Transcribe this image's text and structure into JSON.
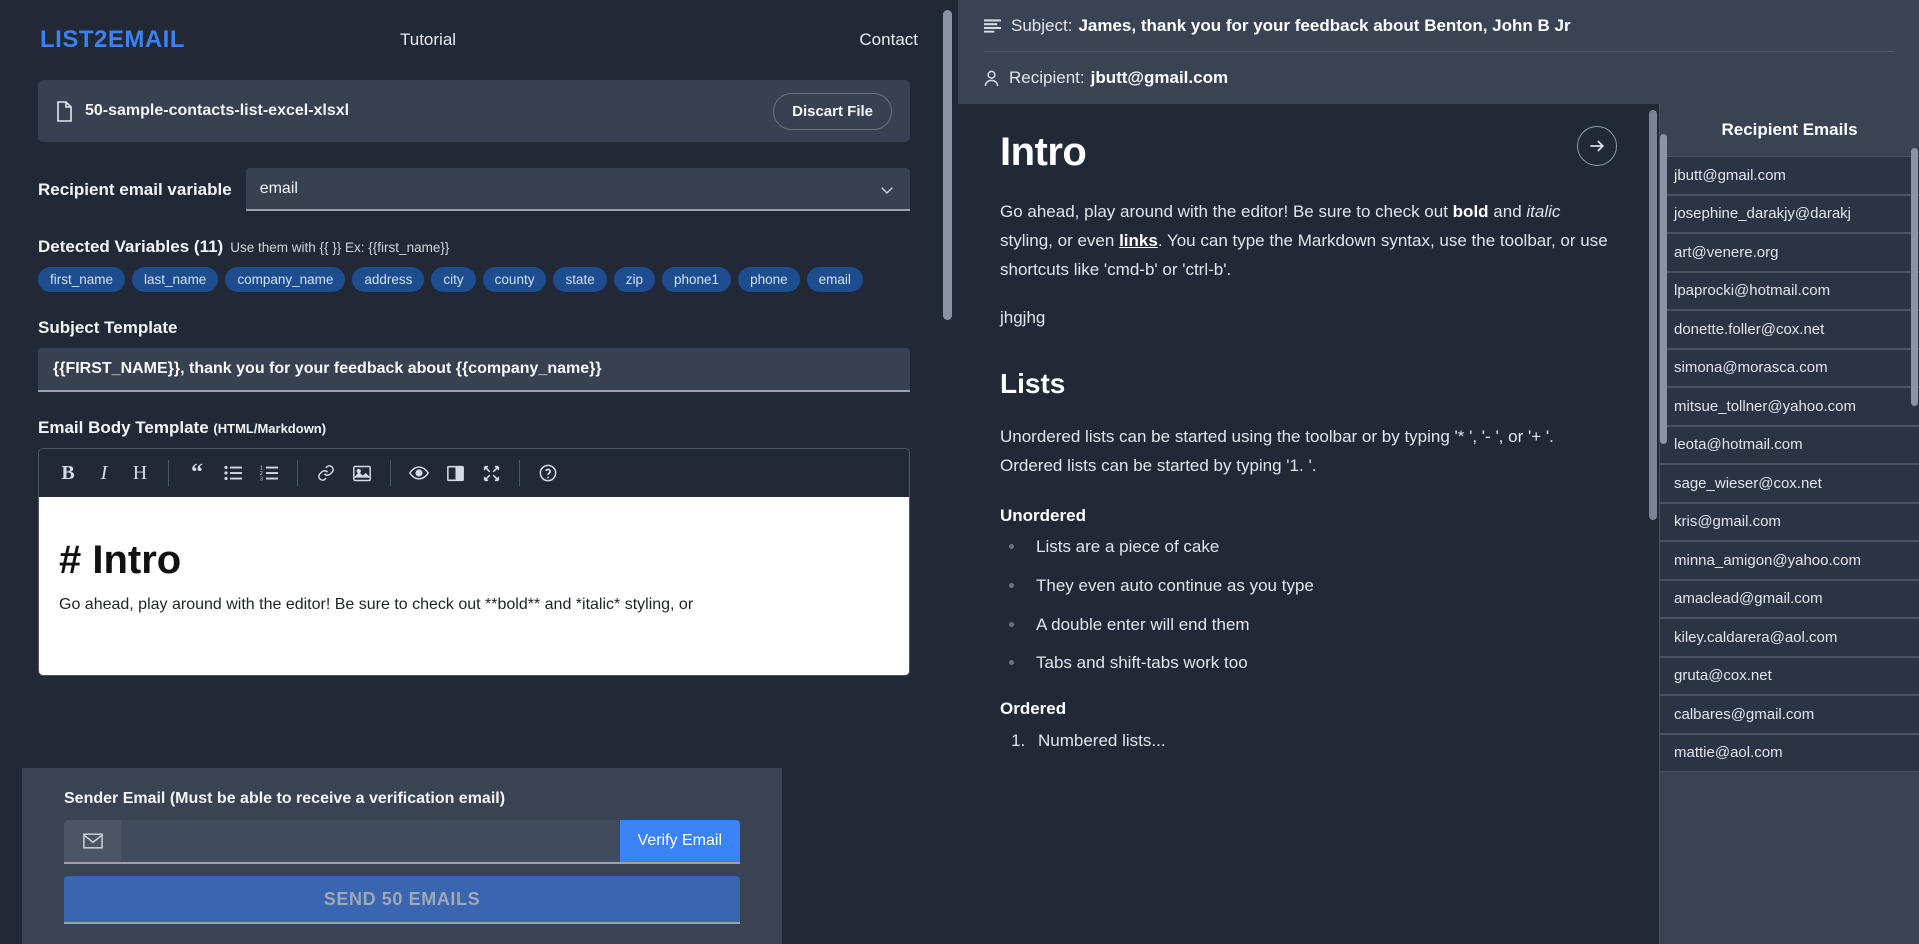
{
  "nav": {
    "brand": "LIST2EMAIL",
    "tutorial": "Tutorial",
    "contact": "Contact"
  },
  "file": {
    "name": "50-sample-contacts-list-excel-xlsxl",
    "discard_label": "Discart File"
  },
  "recipient_variable": {
    "label": "Recipient email variable",
    "value": "email"
  },
  "detected_variables": {
    "title": "Detected Variables (11)",
    "hint": "Use them with {{ }} Ex: {{first_name}}",
    "count": 11,
    "items": [
      "first_name",
      "last_name",
      "company_name",
      "address",
      "city",
      "county",
      "state",
      "zip",
      "phone1",
      "phone",
      "email"
    ]
  },
  "subject_template": {
    "label": "Subject Template",
    "value": "{{FIRST_NAME}}, thank you for your feedback about {{company_name}}"
  },
  "body_template": {
    "label": "Email Body Template",
    "sub_label": "(HTML/Markdown)",
    "toolbar": [
      {
        "name": "bold-icon",
        "glyph": "B"
      },
      {
        "name": "italic-icon",
        "glyph": "I"
      },
      {
        "name": "heading-icon",
        "glyph": "H"
      },
      {
        "name": "separator",
        "glyph": ""
      },
      {
        "name": "quote-icon",
        "glyph": "“"
      },
      {
        "name": "unordered-list-icon",
        "glyph": "☰"
      },
      {
        "name": "ordered-list-icon",
        "glyph": "☰"
      },
      {
        "name": "separator",
        "glyph": ""
      },
      {
        "name": "link-icon",
        "glyph": "🔗"
      },
      {
        "name": "image-icon",
        "glyph": "🖼"
      },
      {
        "name": "separator",
        "glyph": ""
      },
      {
        "name": "preview-eye-icon",
        "glyph": "◉"
      },
      {
        "name": "side-by-side-icon",
        "glyph": "◫"
      },
      {
        "name": "fullscreen-icon",
        "glyph": "⤢"
      },
      {
        "name": "separator",
        "glyph": ""
      },
      {
        "name": "help-icon",
        "glyph": "?"
      }
    ],
    "editor_heading": "# Intro",
    "editor_paragraph": "Go ahead, play around with the editor! Be sure to check out **bold** and *italic* styling, or"
  },
  "sender": {
    "label": "Sender Email (Must be able to receive a verification email)",
    "value": "",
    "placeholder": "",
    "verify_label": "Verify Email",
    "send_label": "SEND 50 EMAILS"
  },
  "preview": {
    "subject_label": "Subject:",
    "subject_value": "James, thank you for your feedback about Benton, John B Jr",
    "recipient_label": "Recipient:",
    "recipient_value": "jbutt@gmail.com",
    "next_arrow": "→",
    "heading": "Intro",
    "intro_parts": {
      "p1a": "Go ahead, play around with the editor! Be sure to check out ",
      "p1_bold": "bold",
      "p1b": " and ",
      "p1_italic": "italic",
      "p1c": " styling, or even ",
      "p1_link": "links",
      "p1d": ". You can type the Markdown syntax, use the toolbar, or use shortcuts like 'cmd-b' or 'ctrl-b'."
    },
    "p2": "jhgjhg",
    "lists_heading": "Lists",
    "lists_paragraph": "Unordered lists can be started using the toolbar or by typing '* ', '- ', or '+ '. Ordered lists can be started by typing '1. '.",
    "unordered_heading": "Unordered",
    "unordered_items": [
      "Lists are a piece of cake",
      "They even auto continue as you type",
      "A double enter will end them",
      "Tabs and shift-tabs work too"
    ],
    "ordered_heading": "Ordered",
    "ordered_items": [
      "Numbered lists..."
    ]
  },
  "recipient_emails": {
    "title": "Recipient Emails",
    "items": [
      "jbutt@gmail.com",
      "josephine_darakjy@darakj",
      "art@venere.org",
      "lpaprocki@hotmail.com",
      "donette.foller@cox.net",
      "simona@morasca.com",
      "mitsue_tollner@yahoo.com",
      "leota@hotmail.com",
      "sage_wieser@cox.net",
      "kris@gmail.com",
      "minna_amigon@yahoo.com",
      "amaclead@gmail.com",
      "kiley.caldarera@aol.com",
      "gruta@cox.net",
      "calbares@gmail.com",
      "mattie@aol.com"
    ]
  },
  "colors": {
    "background": "#212936",
    "panel": "#3a4354",
    "accent": "#3b82f6",
    "chip": "#1e4d8f",
    "send_button": "#3a65b0"
  }
}
